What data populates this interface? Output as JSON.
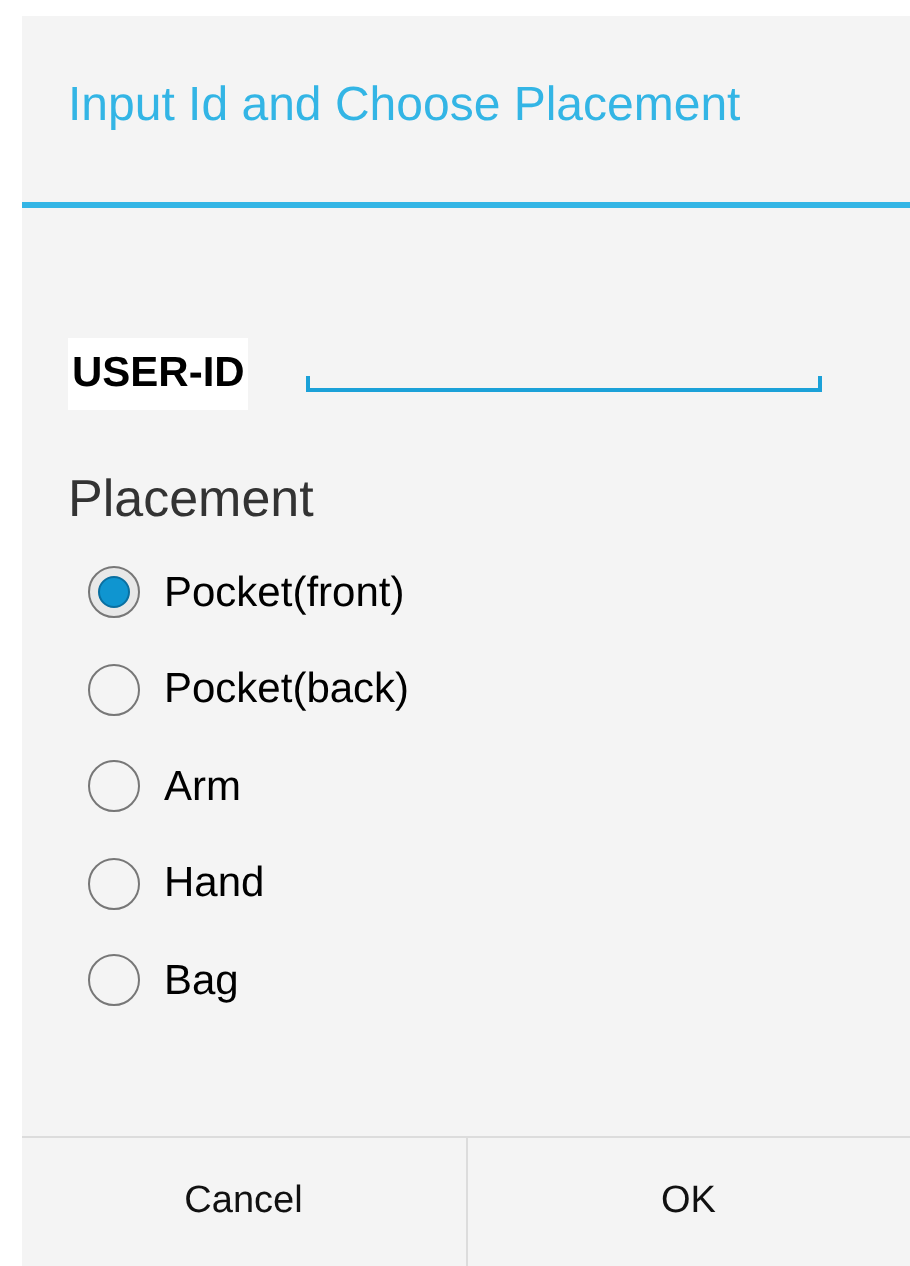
{
  "dialog": {
    "title": "Input Id and Choose Placement"
  },
  "user_id": {
    "label": "USER-ID"
  },
  "placement": {
    "label": "Placement",
    "options": [
      {
        "label": "Pocket(front)",
        "selected": true
      },
      {
        "label": "Pocket(back)",
        "selected": false
      },
      {
        "label": "Arm",
        "selected": false
      },
      {
        "label": "Hand",
        "selected": false
      },
      {
        "label": "Bag",
        "selected": false
      }
    ]
  },
  "buttons": [
    {
      "label": "Cancel"
    },
    {
      "label": "OK"
    }
  ]
}
